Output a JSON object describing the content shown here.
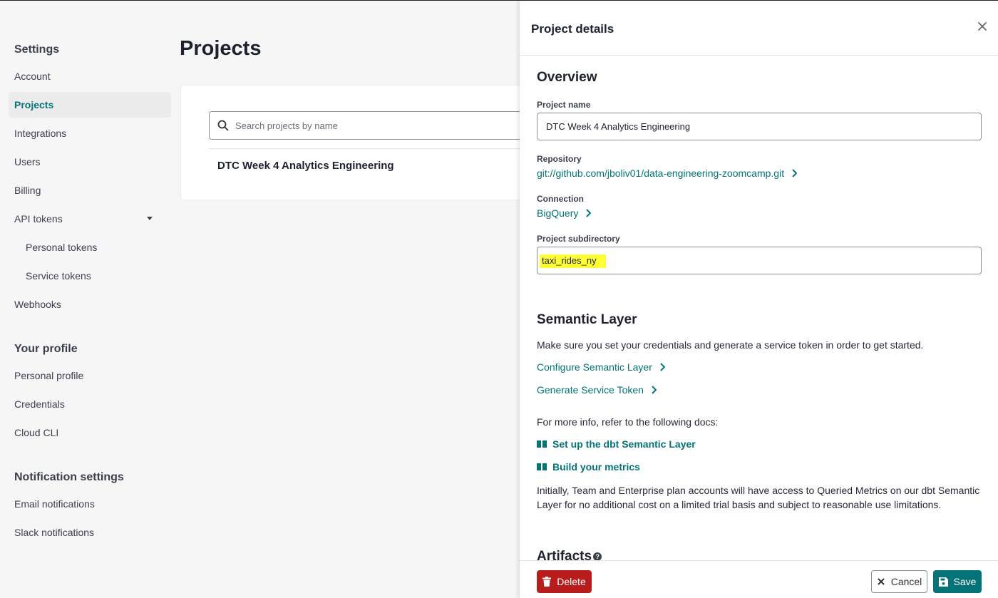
{
  "sidebar": {
    "settings_heading": "Settings",
    "settings_items": [
      {
        "label": "Account"
      },
      {
        "label": "Projects",
        "active": true
      },
      {
        "label": "Integrations"
      },
      {
        "label": "Users"
      },
      {
        "label": "Billing"
      },
      {
        "label": "API tokens",
        "expanded": true
      },
      {
        "label": "Personal tokens"
      },
      {
        "label": "Service tokens"
      },
      {
        "label": "Webhooks"
      }
    ],
    "profile_heading": "Your profile",
    "profile_items": [
      {
        "label": "Personal profile"
      },
      {
        "label": "Credentials"
      },
      {
        "label": "Cloud CLI"
      }
    ],
    "notification_heading": "Notification settings",
    "notification_items": [
      {
        "label": "Email notifications"
      },
      {
        "label": "Slack notifications"
      }
    ]
  },
  "main": {
    "title": "Projects",
    "search_placeholder": "Search projects by name",
    "projects": [
      {
        "name": "DTC Week 4 Analytics Engineering"
      }
    ]
  },
  "drawer": {
    "title": "Project details",
    "overview": {
      "heading": "Overview",
      "project_name_label": "Project name",
      "project_name_value": "DTC Week 4 Analytics Engineering",
      "repository_label": "Repository",
      "repository_value": "git://github.com/jboliv01/data-engineering-zoomcamp.git",
      "connection_label": "Connection",
      "connection_value": "BigQuery",
      "subdirectory_label": "Project subdirectory",
      "subdirectory_value": "taxi_rides_ny"
    },
    "semantic_layer": {
      "heading": "Semantic Layer",
      "intro": "Make sure you set your credentials and generate a service token in order to get started.",
      "configure_link": "Configure Semantic Layer",
      "generate_link": "Generate Service Token",
      "docs_intro": "For more info, refer to the following docs:",
      "doc_links": [
        "Set up the dbt Semantic Layer",
        "Build your metrics"
      ],
      "note": "Initially, Team and Enterprise plan accounts will have access to Queried Metrics on our dbt Semantic Layer for no additional cost on a limited trial basis and subject to reasonable use limitations."
    },
    "artifacts_heading": "Artifacts",
    "footer": {
      "delete_label": "Delete",
      "cancel_label": "Cancel",
      "save_label": "Save"
    }
  },
  "colors": {
    "accent": "#047377",
    "danger": "#b91c1c",
    "highlight": "#ffff33"
  }
}
